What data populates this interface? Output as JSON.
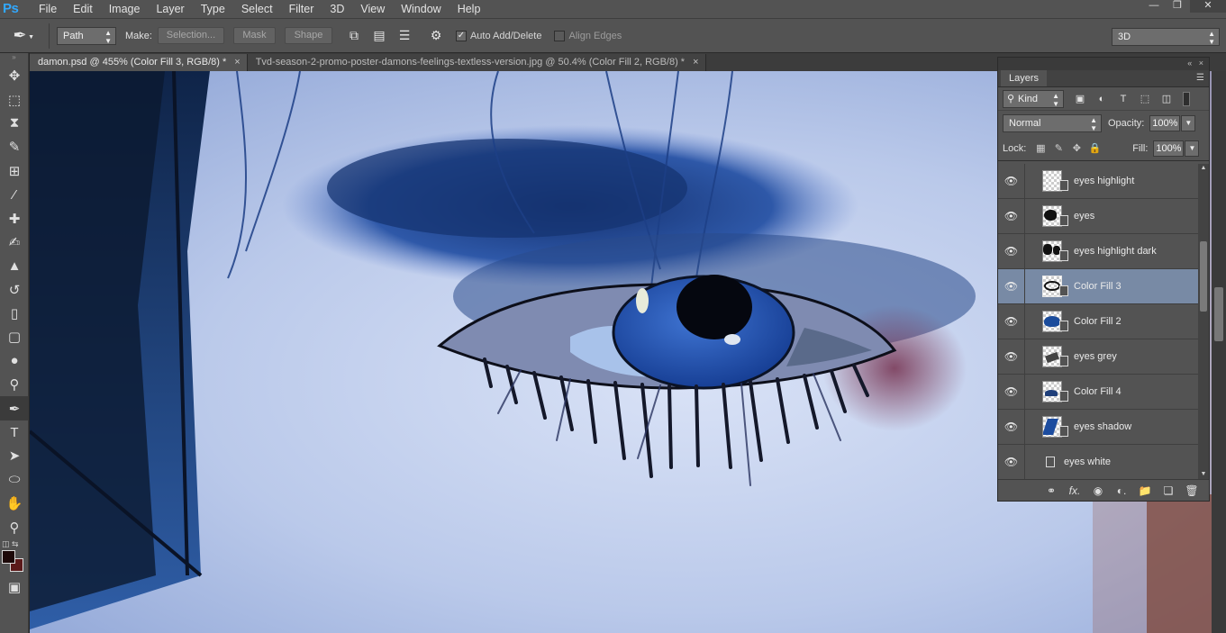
{
  "app": {
    "logo": "Ps"
  },
  "menu": [
    "File",
    "Edit",
    "Image",
    "Layer",
    "Type",
    "Select",
    "Filter",
    "3D",
    "View",
    "Window",
    "Help"
  ],
  "options": {
    "mode": "Path",
    "make_label": "Make:",
    "selection_btn": "Selection...",
    "mask_btn": "Mask",
    "shape_btn": "Shape",
    "auto_add_delete": "Auto Add/Delete",
    "auto_add_delete_checked": true,
    "align_edges": "Align Edges",
    "align_edges_checked": false,
    "workspace": "3D"
  },
  "tabs": [
    {
      "label": "damon.psd @ 455% (Color Fill 3, RGB/8) *",
      "active": true
    },
    {
      "label": "Tvd-season-2-promo-poster-damons-feelings-textless-version.jpg @ 50.4% (Color Fill 2, RGB/8) *",
      "active": false
    }
  ],
  "tools": [
    "move-tool",
    "marquee-tool",
    "lasso-tool",
    "quick-selection-tool",
    "crop-tool",
    "eyedropper-tool",
    "spot-healing-tool",
    "brush-tool",
    "clone-stamp-tool",
    "history-brush-tool",
    "eraser-tool",
    "gradient-tool",
    "blur-tool",
    "dodge-tool",
    "pen-tool",
    "type-tool",
    "path-selection-tool",
    "ellipse-tool",
    "hand-tool",
    "zoom-tool"
  ],
  "colors": {
    "foreground": "#1d0909",
    "background": "#5b1a1a",
    "selected_layer": "#788aa5"
  },
  "layers_panel": {
    "title": "Layers",
    "filter_kind": "Kind",
    "blend_mode": "Normal",
    "opacity_label": "Opacity:",
    "opacity": "100%",
    "lock_label": "Lock:",
    "fill_label": "Fill:",
    "fill": "100%",
    "layers": [
      {
        "name": "eyes highlight",
        "thumb": "checker",
        "selected": false
      },
      {
        "name": "eyes",
        "thumb": "dark-shape",
        "selected": false
      },
      {
        "name": "eyes highlight dark",
        "thumb": "dark-shape",
        "selected": false
      },
      {
        "name": "Color Fill 3",
        "thumb": "eye-outline",
        "selected": true
      },
      {
        "name": "Color Fill 2",
        "thumb": "blue-shape",
        "selected": false
      },
      {
        "name": "eyes grey",
        "thumb": "grey-shape",
        "selected": false
      },
      {
        "name": "Color Fill 4",
        "thumb": "blue-shape",
        "selected": false
      },
      {
        "name": "eyes shadow",
        "thumb": "blue-stroke",
        "selected": false
      },
      {
        "name": "eyes white",
        "thumb": "none",
        "selected": false
      }
    ]
  }
}
